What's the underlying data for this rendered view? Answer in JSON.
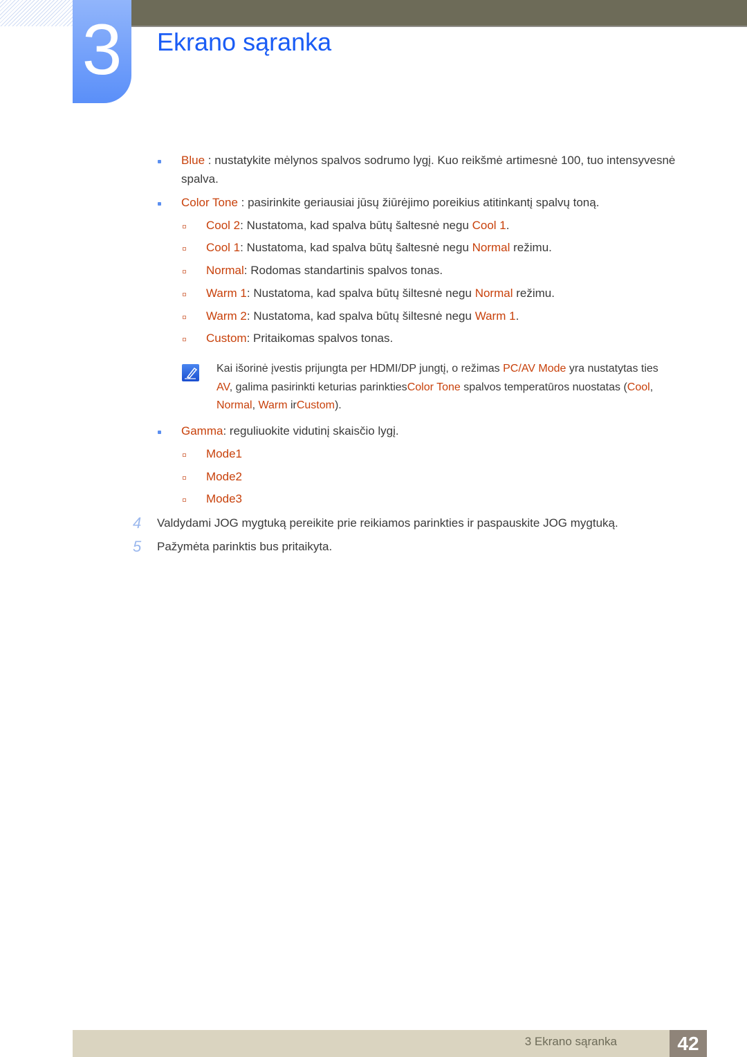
{
  "header": {
    "chapter_number": "3",
    "title": "Ekrano sąranka"
  },
  "colors": {
    "highlight": "#c8410b",
    "title": "#1a5cf5",
    "bar": "#6d6b58"
  },
  "lines": [
    {
      "kind": "b1",
      "segs": [
        [
          "Blue",
          1
        ],
        [
          " : nustatykite mėlynos spalvos sodrumo lygį. Kuo reikšmė artimesnė 100, tuo intensyvesnė",
          0
        ]
      ]
    },
    {
      "kind": "cont",
      "segs": [
        [
          "spalva.",
          0
        ]
      ]
    },
    {
      "kind": "b1",
      "segs": [
        [
          "Color Tone",
          1
        ],
        [
          " : pasirinkite geriausiai jūsų žiūrėjimo poreikius atitinkantį spalvų toną.",
          0
        ]
      ]
    },
    {
      "kind": "b2",
      "segs": [
        [
          "Cool 2",
          1
        ],
        [
          ": Nustatoma, kad spalva būtų šaltesnė negu ",
          0
        ],
        [
          "Cool 1",
          1
        ],
        [
          ".",
          0
        ]
      ]
    },
    {
      "kind": "b2",
      "segs": [
        [
          "Cool 1",
          1
        ],
        [
          ": Nustatoma, kad spalva būtų šaltesnė negu ",
          0
        ],
        [
          "Normal",
          1
        ],
        [
          " režimu.",
          0
        ]
      ]
    },
    {
      "kind": "b2",
      "segs": [
        [
          "Normal",
          1
        ],
        [
          ": Rodomas standartinis spalvos tonas.",
          0
        ]
      ]
    },
    {
      "kind": "b2",
      "segs": [
        [
          "Warm 1",
          1
        ],
        [
          ": Nustatoma, kad spalva būtų šiltesnė negu ",
          0
        ],
        [
          "Normal",
          1
        ],
        [
          " režimu.",
          0
        ]
      ]
    },
    {
      "kind": "b2",
      "segs": [
        [
          "Warm 2",
          1
        ],
        [
          ": Nustatoma, kad spalva būtų šiltesnė negu ",
          0
        ],
        [
          "Warm 1",
          1
        ],
        [
          ".",
          0
        ]
      ]
    },
    {
      "kind": "b2",
      "segs": [
        [
          "Custom",
          1
        ],
        [
          ": Pritaikomas spalvos tonas.",
          0
        ]
      ]
    },
    {
      "kind": "note",
      "segs": [
        [
          "Kai išorinė įvestis prijungta per HDMI/DP jungtį, o režimas ",
          0
        ],
        [
          "PC/AV Mode",
          1
        ],
        [
          " yra nustatytas ties",
          0
        ]
      ]
    },
    {
      "kind": "note2",
      "segs": [
        [
          "AV",
          1
        ],
        [
          ", galima pasirinkti keturias parinkties",
          0
        ],
        [
          "Color Tone",
          1
        ],
        [
          " spalvos temperatūros nuostatas (",
          0
        ],
        [
          "Cool",
          1
        ],
        [
          ",",
          0
        ]
      ]
    },
    {
      "kind": "note2",
      "segs": [
        [
          "Normal",
          1
        ],
        [
          ", ",
          0
        ],
        [
          "Warm",
          1
        ],
        [
          " ir",
          0
        ],
        [
          "Custom",
          1
        ],
        [
          ").",
          0
        ]
      ]
    },
    {
      "kind": "b1",
      "segs": [
        [
          "Gamma",
          1
        ],
        [
          ": reguliuokite vidutinį skaisčio lygį.",
          0
        ]
      ]
    },
    {
      "kind": "b2",
      "segs": [
        [
          "Mode1",
          1
        ]
      ]
    },
    {
      "kind": "b2",
      "segs": [
        [
          "Mode2",
          1
        ]
      ]
    },
    {
      "kind": "b2",
      "segs": [
        [
          "Mode3",
          1
        ]
      ]
    }
  ],
  "steps": [
    {
      "number": "4",
      "text": "Valdydami JOG mygtuką pereikite prie reikiamos parinkties ir paspauskite JOG mygtuką."
    },
    {
      "number": "5",
      "text": "Pažymėta parinktis bus pritaikyta."
    }
  ],
  "footer": {
    "text": "3 Ekrano sąranka",
    "page": "42"
  }
}
